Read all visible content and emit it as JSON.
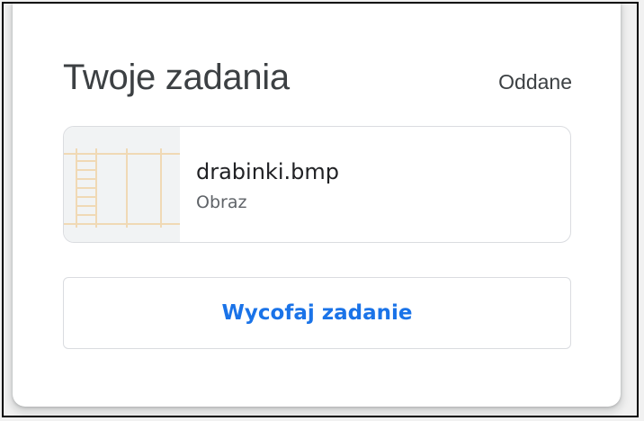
{
  "header": {
    "title": "Twoje zadania",
    "status": "Oddane"
  },
  "attachment": {
    "file_name": "drabinki.bmp",
    "file_type": "Obraz",
    "thumbnail_icon": "image-thumbnail"
  },
  "actions": {
    "unsubmit_label": "Wycofaj zadanie"
  },
  "colors": {
    "accent": "#1a73e8",
    "text_primary": "#3c4043",
    "text_secondary": "#5f6368",
    "thumbnail_lines": "#f0d9b5"
  }
}
